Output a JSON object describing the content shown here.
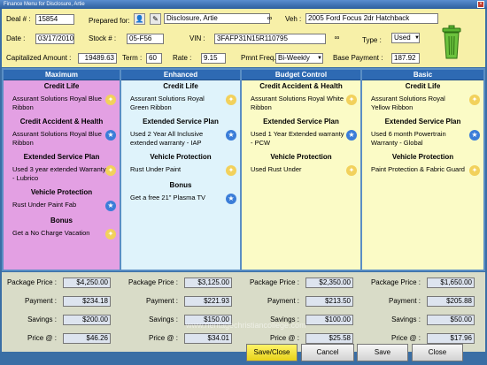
{
  "window": {
    "title": "Finance Menu for Disclosure, Artie"
  },
  "deal": {
    "deal_label": "Deal # :",
    "deal_value": "15854",
    "prepared_label": "Prepared for:",
    "prepared_value": "Disclosure, Artie",
    "veh_label": "Veh :",
    "veh_value": "2005 Ford Focus 2dr Hatchback",
    "date_label": "Date :",
    "date_value": "03/17/2010",
    "stock_label": "Stock # :",
    "stock_value": "05-F56",
    "vin_label": "VIN :",
    "vin_value": "3FAFP31N15R110795",
    "type_label": "Type :",
    "type_value": "Used",
    "cap_label": "Capitalized Amount :",
    "cap_value": "19489.63",
    "term_label": "Term :",
    "term_value": "60",
    "rate_label": "Rate :",
    "rate_value": "9.15",
    "freq_label": "Pmnt Freq.",
    "freq_value": "Bi-Weekly",
    "base_label": "Base Payment :",
    "base_value": "187.92"
  },
  "columns": [
    {
      "name": "Maximum",
      "color": "#e3a0e3",
      "entries": [
        {
          "kind": "section",
          "text": "Credit Life"
        },
        {
          "kind": "item",
          "text": "Assurant Solutions Royal Blue Ribbon"
        },
        {
          "kind": "section",
          "text": "Credit Accident & Health"
        },
        {
          "kind": "item",
          "text": "Assurant Solutions Royal Blue Ribbon"
        },
        {
          "kind": "section",
          "text": "Extended Service Plan"
        },
        {
          "kind": "item",
          "text": "Used 3 year extended Warranty - Lubrico"
        },
        {
          "kind": "section",
          "text": "Vehicle Protection"
        },
        {
          "kind": "item",
          "text": "Rust Under Paint Fab"
        },
        {
          "kind": "section",
          "text": "Bonus"
        },
        {
          "kind": "item",
          "text": "Get a No Charge Vacation"
        }
      ],
      "package_price": "$4,250.00",
      "payment": "$234.18",
      "savings": "$200.00",
      "price_at": "$46.26"
    },
    {
      "name": "Enhanced",
      "color": "#dff3fb",
      "entries": [
        {
          "kind": "section",
          "text": "Credit Life"
        },
        {
          "kind": "item",
          "text": "Assurant Solutions Royal Green Ribbon"
        },
        {
          "kind": "section",
          "text": "Extended Service Plan"
        },
        {
          "kind": "item",
          "text": "Used 2 Year All Inclusive extended warranty - IAP"
        },
        {
          "kind": "section",
          "text": "Vehicle Protection"
        },
        {
          "kind": "item",
          "text": "Rust Under Paint"
        },
        {
          "kind": "section",
          "text": "Bonus"
        },
        {
          "kind": "item",
          "text": "Get a free 21\" Plasma TV"
        }
      ],
      "package_price": "$3,125.00",
      "payment": "$221.93",
      "savings": "$150.00",
      "price_at": "$34.01"
    },
    {
      "name": "Budget Control",
      "color": "#fbfbc6",
      "entries": [
        {
          "kind": "section",
          "text": "Credit Accident & Health"
        },
        {
          "kind": "item",
          "text": "Assurant Solutions Royal White Ribbon"
        },
        {
          "kind": "section",
          "text": "Extended Service Plan"
        },
        {
          "kind": "item",
          "text": "Used 1 Year Extended warranty - PCW"
        },
        {
          "kind": "section",
          "text": "Vehicle Protection"
        },
        {
          "kind": "item",
          "text": "Used Rust Under"
        }
      ],
      "package_price": "$2,350.00",
      "payment": "$213.50",
      "savings": "$100.00",
      "price_at": "$25.58"
    },
    {
      "name": "Basic",
      "color": "#fbfbc6",
      "entries": [
        {
          "kind": "section",
          "text": "Credit Life"
        },
        {
          "kind": "item",
          "text": "Assurant Solutions Royal Yellow Ribbon"
        },
        {
          "kind": "section",
          "text": "Extended Service Plan"
        },
        {
          "kind": "item",
          "text": "Used 6 month Powertrain Warranty - Global"
        },
        {
          "kind": "section",
          "text": "Vehicle Protection"
        },
        {
          "kind": "item",
          "text": "Paint Protection & Fabric Guard"
        }
      ],
      "package_price": "$1,650.00",
      "payment": "$205.88",
      "savings": "$50.00",
      "price_at": "$17.96"
    }
  ],
  "summary_labels": {
    "package_price": "Package Price :",
    "payment": "Payment :",
    "savings": "Savings :",
    "price_at": "Price @ :"
  },
  "buttons": {
    "save_close": "Save/Close",
    "cancel": "Cancel",
    "save": "Save",
    "close": "Close"
  },
  "watermark": "www.heritagechristiancollege.com"
}
